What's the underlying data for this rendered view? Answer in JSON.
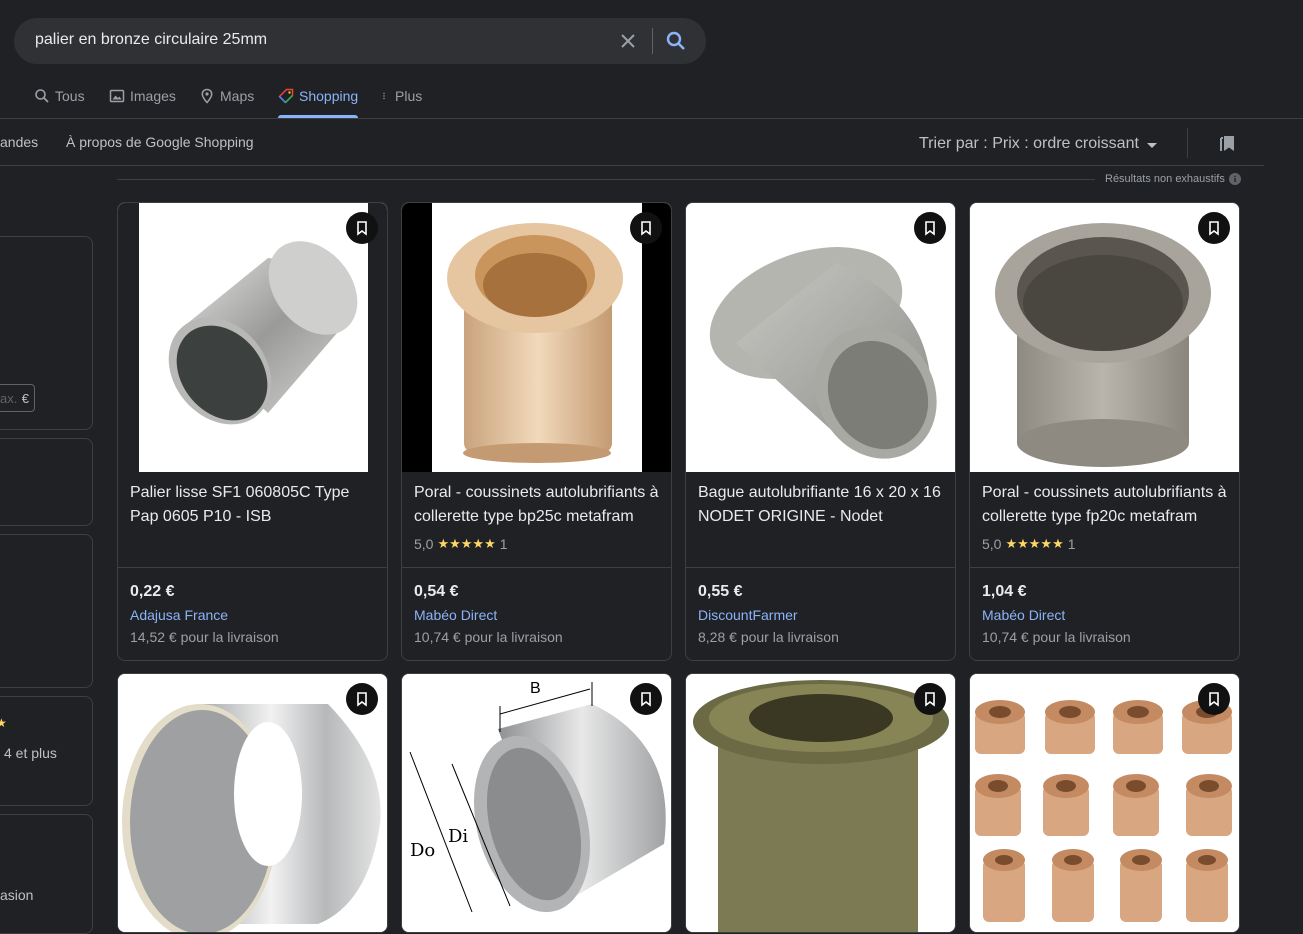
{
  "search": {
    "query": "palier en bronze circulaire 25mm"
  },
  "tabs": [
    {
      "label": "Tous",
      "icon": "search-icon"
    },
    {
      "label": "Images",
      "icon": "image-icon"
    },
    {
      "label": "Maps",
      "icon": "map-pin-icon"
    },
    {
      "label": "Shopping",
      "icon": "tag-icon",
      "active": true
    },
    {
      "label": "Plus",
      "icon": "more-vert-icon"
    }
  ],
  "subbar": {
    "orders_label": "andes",
    "about_label": "À propos de Google Shopping",
    "sort_label": "Trier par : Prix : ordre croissant"
  },
  "results_note": "Résultats non exhaustifs",
  "filters": {
    "max_placeholder": "ax.",
    "currency": "€",
    "rating_label": "4 et plus",
    "rating_stars": "★",
    "delivery_label": "asion"
  },
  "products": [
    {
      "title": "Palier lisse SF1 060805C Type Pap 0605 P10 - ISB",
      "price": "0,22 €",
      "merchant": "Adajusa France",
      "delivery": "14,52 € pour la livraison"
    },
    {
      "title": "Poral - coussinets autolubrifiants à collerette type bp25c metafram",
      "rating_value": "5,0",
      "stars": "★★★★★",
      "review_count": "1",
      "price": "0,54 €",
      "merchant": "Mabéo Direct",
      "delivery": "10,74 € pour la livraison"
    },
    {
      "title": "Bague autolubrifiante 16 x 20 x 16 NODET ORIGINE - Nodet",
      "price": "0,55 €",
      "merchant": "DiscountFarmer",
      "delivery": "8,28 € pour la livraison"
    },
    {
      "title": "Poral - coussinets autolubrifiants à collerette type fp20c metafram",
      "rating_value": "5,0",
      "stars": "★★★★★",
      "review_count": "1",
      "price": "1,04 €",
      "merchant": "Mabéo Direct",
      "delivery": "10,74 € pour la livraison"
    }
  ],
  "diagram_labels": {
    "b": "B",
    "do": "Do",
    "di": "Di"
  },
  "colors": {
    "background": "#202124",
    "accent": "#8ab4f8",
    "star": "#fdd663",
    "bronze": "#c9906a"
  }
}
